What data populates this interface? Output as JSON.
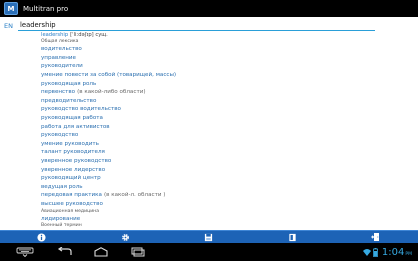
{
  "app": {
    "title": "Multitran pro",
    "icon_label": "M"
  },
  "search": {
    "lang": "EN",
    "value": "leadership"
  },
  "results": [
    {
      "type": "head",
      "word": "leadership",
      "forms": "[ˈliːdəʃɪp] сущ."
    },
    {
      "type": "sub",
      "text": "Общая лексика"
    },
    {
      "type": "item",
      "text": "водительство"
    },
    {
      "type": "item",
      "text": "управление"
    },
    {
      "type": "item",
      "text": "руководители"
    },
    {
      "type": "item",
      "text": "умение повести за собой (товарищей, массы)"
    },
    {
      "type": "item",
      "text": "руководящая роль"
    },
    {
      "type": "item",
      "text": "первенство",
      "note": "(в какой-либо области)"
    },
    {
      "type": "item",
      "text": "предводительство"
    },
    {
      "type": "item",
      "text": "руководство водительство"
    },
    {
      "type": "item",
      "text": "руководящая работа"
    },
    {
      "type": "item",
      "text": "работа для активистов"
    },
    {
      "type": "item",
      "text": "руководство"
    },
    {
      "type": "item",
      "text": "умение руководить"
    },
    {
      "type": "item",
      "text": "талант руководителя"
    },
    {
      "type": "item",
      "text": "уверенное руководство"
    },
    {
      "type": "item",
      "text": "уверенное лидерство"
    },
    {
      "type": "item",
      "text": "руководящий центр"
    },
    {
      "type": "item",
      "text": "ведущая роль"
    },
    {
      "type": "item",
      "text": "передовая практика",
      "note": "(в какой-л. области )"
    },
    {
      "type": "item",
      "text": "высшее руководство"
    },
    {
      "type": "sub",
      "text": "Авиационная медицина"
    },
    {
      "type": "item",
      "text": "лидирование"
    },
    {
      "type": "sub",
      "text": "Военный термин"
    },
    {
      "type": "item",
      "text": "руководство войсками"
    }
  ],
  "status": {
    "time": "1:04",
    "time_suffix": "PM"
  },
  "colors": {
    "accent": "#1d63b6",
    "link": "#2a6fb0",
    "clock": "#36a9e1"
  }
}
